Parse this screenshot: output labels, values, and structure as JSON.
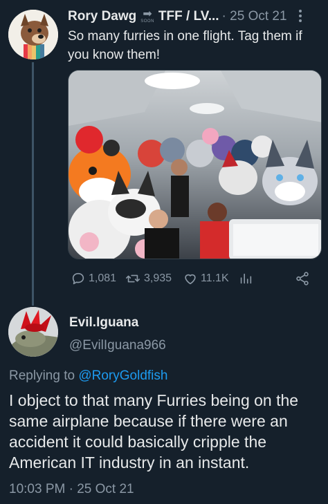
{
  "parent_tweet": {
    "author_name": "Rory Dawg",
    "badge_text": "SOON",
    "author_name_2": "TFF / LV...",
    "meta": "· 25 Oct 21",
    "text": "So many furries in one flight. Tag them if you know them!",
    "stats": {
      "replies": "1,081",
      "retweets": "3,935",
      "likes": "11.1K"
    }
  },
  "reply_tweet": {
    "author_name": "Evil.Iguana",
    "handle": "@EvilIguana966",
    "replying_prefix": "Replying to",
    "replying_mention": "@RoryGoldfish",
    "text": "I object to that many Furries being on the same airplane because if there were an accident it could basically cripple the American IT industry in an instant.",
    "timestamp": "10:03 PM · 25 Oct 21"
  },
  "colors": {
    "background": "#15202b",
    "primary_text": "#e7e9ea",
    "secondary_text": "#8b98a5",
    "link": "#1d9bf0"
  },
  "icons": [
    "reply-icon",
    "retweet-icon",
    "like-icon",
    "analytics-icon",
    "share-icon",
    "more-icon"
  ]
}
